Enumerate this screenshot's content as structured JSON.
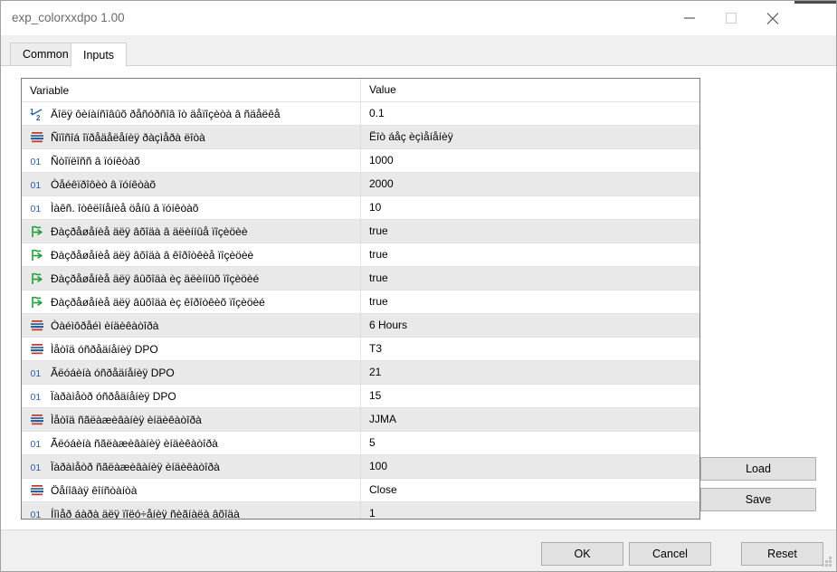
{
  "window": {
    "title": "exp_colorxxdpo 1.00",
    "controls": {
      "minimize": "minimize-icon",
      "maximize": "maximize-icon",
      "close": "close-icon"
    }
  },
  "tabs": [
    {
      "id": "common",
      "label": "Common",
      "active": false
    },
    {
      "id": "inputs",
      "label": "Inputs",
      "active": true
    }
  ],
  "table": {
    "headers": {
      "variable": "Variable",
      "value": "Value"
    },
    "rows": [
      {
        "icon": "fraction-half-icon",
        "variable": "Äîëÿ ôèíàíñîâûõ ðåñóðñîâ îò äåïîçèòà â ñäåëêå",
        "value": "0.1"
      },
      {
        "icon": "enum-list-icon",
        "variable": "Ñïîñîá îïðåäåëåíèÿ ðàçìåðà ëîòà",
        "value": "Ëîò áåç èçìåíåíèÿ"
      },
      {
        "icon": "integer-01-icon",
        "variable": "Ñòîïëîññ â ïóíêòàõ",
        "value": "1000"
      },
      {
        "icon": "integer-01-icon",
        "variable": "Òåéêïðîôèò â ïóíêòàõ",
        "value": "2000"
      },
      {
        "icon": "integer-01-icon",
        "variable": "Ìàêñ. îòêëîíåíèå öåíû â ïóíêòàõ",
        "value": "10"
      },
      {
        "icon": "boolean-flag-icon",
        "variable": "Ðàçðåøåíèå äëÿ âõîäà â äëèííûå ïîçèöèè",
        "value": "true"
      },
      {
        "icon": "boolean-flag-icon",
        "variable": "Ðàçðåøåíèå äëÿ âõîäà â êîðîòêèå ïîçèöèè",
        "value": "true"
      },
      {
        "icon": "boolean-flag-icon",
        "variable": "Ðàçðåøåíèå äëÿ âûõîäà èç äëèííûõ ïîçèöèé",
        "value": "true"
      },
      {
        "icon": "boolean-flag-icon",
        "variable": "Ðàçðåøåíèå äëÿ âûõîäà èç êîðîòêèõ ïîçèöèé",
        "value": "true"
      },
      {
        "icon": "enum-list-icon",
        "variable": "Òàéìôðåéì èíäèêàòîðà",
        "value": "6 Hours"
      },
      {
        "icon": "enum-list-icon",
        "variable": "Ìåòîä óñðåäíåíèÿ DPO",
        "value": "T3"
      },
      {
        "icon": "integer-01-icon",
        "variable": "Ãëóáèíà  óñðåäíåíèÿ DPO",
        "value": "21"
      },
      {
        "icon": "integer-01-icon",
        "variable": "Ïàðàìåòð óñðåäíåíèÿ DPO",
        "value": "15"
      },
      {
        "icon": "enum-list-icon",
        "variable": "Ìåòîä ñãëàæèâàíèÿ èíäèêàòîðà",
        "value": "JJMA"
      },
      {
        "icon": "integer-01-icon",
        "variable": "Ãëóáèíà ñãëàæèâàíèÿ èíäèêàòîðà",
        "value": "5"
      },
      {
        "icon": "integer-01-icon",
        "variable": "Ïàðàìåòð ñãëàæèâàíèÿ èíäèêàòîðà",
        "value": "100"
      },
      {
        "icon": "enum-list-icon",
        "variable": "Öåíîâàÿ êîíñòàíòà",
        "value": "Close"
      },
      {
        "icon": "integer-01-icon",
        "variable": "Íîìåð áàðà äëÿ ïîëó÷åíèÿ ñèãíàëà âõîäà",
        "value": "1"
      }
    ]
  },
  "side_buttons": {
    "load": "Load",
    "save": "Save"
  },
  "footer_buttons": {
    "ok": "OK",
    "cancel": "Cancel",
    "reset": "Reset"
  },
  "colors": {
    "window_bg": "#f0f0f0",
    "panel_bg": "#ffffff",
    "alt_row": "#e9e9e9",
    "button_face": "#e1e1e1",
    "button_border": "#adadad",
    "grid_line": "#e2e2e2",
    "title_text": "#6b6b6b",
    "icon_blue": "#2a6099",
    "icon_red": "#c0392b",
    "icon_green": "#1f9e3a"
  }
}
